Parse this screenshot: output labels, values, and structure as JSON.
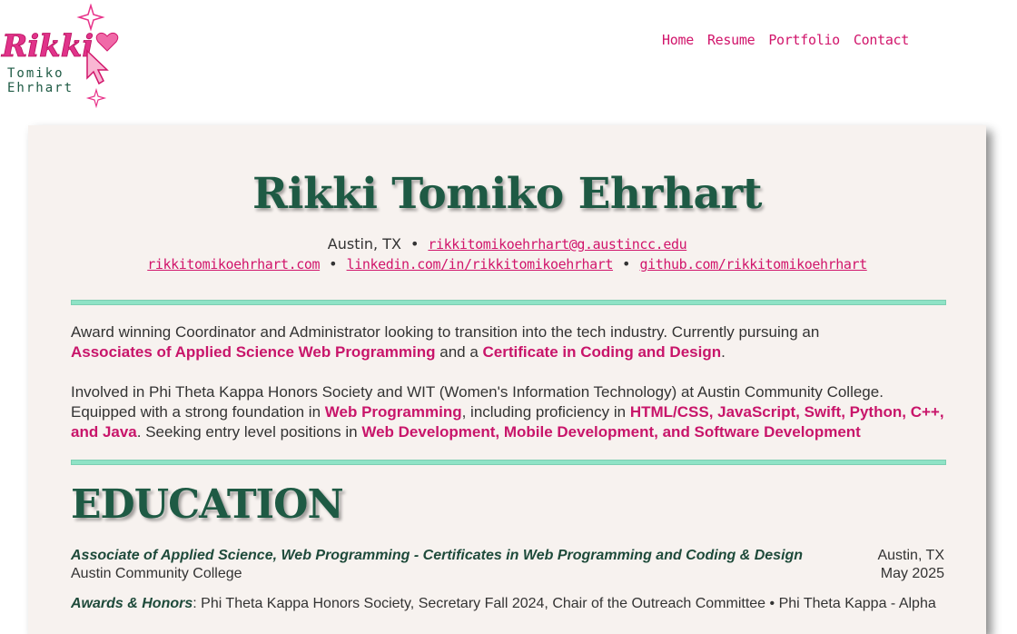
{
  "logo": {
    "script_name": "Rikki",
    "line1": "Tomiko",
    "line2": "Ehrhart"
  },
  "nav": {
    "items": [
      "Home",
      "Resume",
      "Portfolio",
      "Contact"
    ]
  },
  "header": {
    "name": "Rikki Tomiko Ehrhart",
    "location": "Austin, TX",
    "email": "rikkitomikoehrhart@g.austincc.edu",
    "website": "rikkitomikoehrhart.com",
    "linkedin": "linkedin.com/in/rikkitomikoehrhart",
    "github": "github.com/rikkitomikoehrhart",
    "separator": "•"
  },
  "summary": {
    "p1_text1": "Award winning Coordinator and Administrator looking to transition into the tech industry. Currently pursuing an",
    "p1_hl1": "Associates of Applied Science Web Programming",
    "p1_text2": "and a",
    "p1_hl2": "Certificate in Coding and Design",
    "p1_text3": ".",
    "p2_text1": "Involved in Phi Theta Kappa Honors Society and WIT (Women's Information Technology) at Austin Community College. Equipped with a strong foundation in",
    "p2_hl1": "Web Programming",
    "p2_text2": ", including proficiency in",
    "p2_hl2": "HTML/CSS, JavaScript, Swift, Python, C++, and Java",
    "p2_text3": ". Seeking entry level positions in",
    "p2_hl3": "Web Development, Mobile Development, and Software Development"
  },
  "education": {
    "heading": "EDUCATION",
    "degree": "Associate of Applied Science, Web Programming - Certificates in Web Programming and Coding & Design",
    "location": "Austin, TX",
    "school": "Austin Community College",
    "date": "May 2025",
    "awards_label": "Awards & Honors",
    "awards_text": ": Phi Theta Kappa Honors Society, Secretary Fall 2024, Chair of the Outreach Committee • Phi Theta Kappa - Alpha"
  },
  "colors": {
    "accent_pink": "#d1156b",
    "heading_green": "#1e5a44",
    "rule_mint": "#8fe3c6",
    "card_bg": "#f7f2ef"
  }
}
